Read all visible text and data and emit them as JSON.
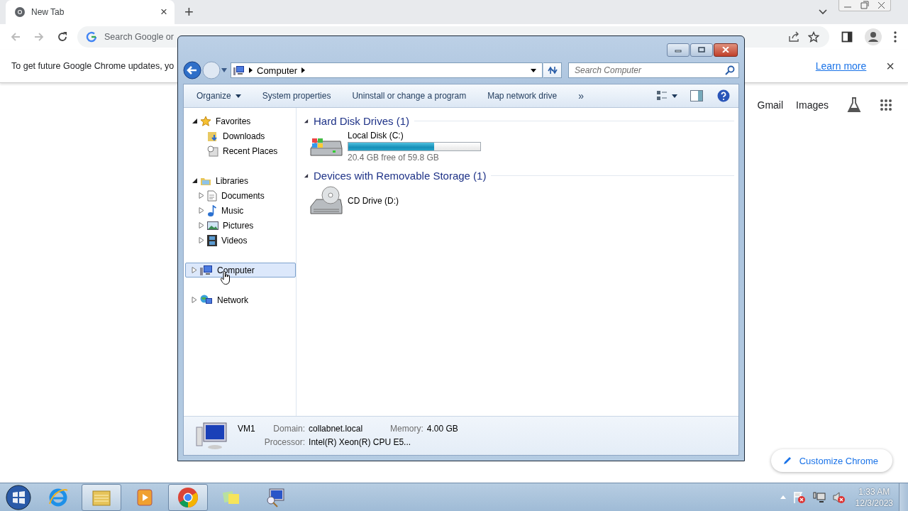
{
  "browser": {
    "tab": {
      "title": "New Tab",
      "close": "×",
      "selected": true
    },
    "new_tab": "+",
    "omnibox": {
      "placeholder": "Search Google or"
    },
    "infobar": {
      "message": "To get future Google Chrome updates, yo",
      "link": "Learn more",
      "close": "×"
    },
    "links": [
      "Gmail",
      "Images"
    ],
    "customize_button": "Customize Chrome"
  },
  "explorer": {
    "breadcrumb": [
      "Computer"
    ],
    "search": {
      "placeholder": "Search Computer"
    },
    "toolbar": [
      {
        "label": "Organize",
        "menu": true
      },
      {
        "label": "System properties",
        "menu": false
      },
      {
        "label": "Uninstall or change a program",
        "menu": false
      },
      {
        "label": "Map network drive",
        "menu": false
      }
    ],
    "toolbar_overflow": "»",
    "nav_tree": [
      {
        "label": "Favorites",
        "expandable": true,
        "expanded": true,
        "selected": false,
        "children": [
          {
            "label": "Downloads",
            "expandable": false,
            "selected": false
          },
          {
            "label": "Recent Places",
            "expandable": false,
            "selected": false
          }
        ]
      },
      {
        "label": "Libraries",
        "expandable": true,
        "expanded": true,
        "selected": false,
        "children": [
          {
            "label": "Documents",
            "expandable": true,
            "expanded": false,
            "selected": false
          },
          {
            "label": "Music",
            "expandable": true,
            "expanded": false,
            "selected": false
          },
          {
            "label": "Pictures",
            "expandable": true,
            "expanded": false,
            "selected": false
          },
          {
            "label": "Videos",
            "expandable": true,
            "expanded": false,
            "selected": false
          }
        ]
      },
      {
        "label": "Computer",
        "expandable": true,
        "expanded": false,
        "selected": true
      },
      {
        "label": "Network",
        "expandable": true,
        "expanded": false,
        "selected": false
      }
    ],
    "sections": [
      {
        "title": "Hard Disk Drives (1)",
        "expanded": true,
        "items": [
          {
            "kind": "disk",
            "name": "Local Disk (C:)",
            "level": 0.65,
            "free": "20.4 GB free of 59.8 GB"
          }
        ]
      },
      {
        "title": "Devices with Removable Storage (1)",
        "expanded": true,
        "items": [
          {
            "kind": "cd",
            "name": "CD Drive (D:)"
          }
        ]
      }
    ],
    "details": {
      "name": "VM1",
      "fields": [
        {
          "label": "Domain:",
          "value": "collabnet.local"
        },
        {
          "label": "Memory:",
          "value": "4.00 GB"
        },
        {
          "label": "Processor:",
          "value": "Intel(R) Xeon(R) CPU E5..."
        }
      ]
    }
  },
  "taskbar": {
    "apps": [
      {
        "selected": false
      },
      {
        "selected": true
      },
      {
        "selected": false
      },
      {
        "selected": true
      },
      {
        "selected": false
      },
      {
        "selected": false
      }
    ],
    "clock": {
      "time": "1:33 AM",
      "date": "12/3/2023"
    }
  }
}
